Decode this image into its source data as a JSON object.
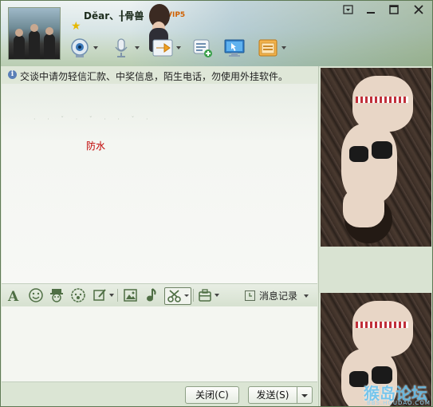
{
  "header": {
    "contact_name": "Dĕar、╂骨兽",
    "vip_label": "VIP5",
    "toolbar_icons": [
      "webcam-icon",
      "microphone-icon",
      "send-file-icon",
      "contact-card-icon",
      "remote-assist-icon",
      "app-box-icon"
    ]
  },
  "window_controls": {
    "menu": "▾",
    "minimize": "▁",
    "maximize": "□",
    "close": "✕"
  },
  "notice": {
    "text": "交谈中请勿轻信汇款、中奖信息，陌生电话，勿使用外挂软件。"
  },
  "chat": {
    "messages": [
      {
        "text": "防水",
        "color": "#c00000"
      }
    ]
  },
  "format_toolbar": {
    "icons": [
      "font-icon",
      "emoji-icon",
      "magic-face-icon",
      "voice-face-icon",
      "scribble-icon",
      "picture-icon",
      "music-icon",
      "screenshot-scissors-icon",
      "more-tools-icon"
    ],
    "history_label": "消息记录"
  },
  "bottom": {
    "close_label": "关闭(C)",
    "send_label": "发送(S)"
  },
  "watermark": {
    "main": "猴岛论坛",
    "sub": "BBS.HOUDAO.COM"
  },
  "colors": {
    "accent": "#5f7a55",
    "message_red": "#c00000"
  }
}
